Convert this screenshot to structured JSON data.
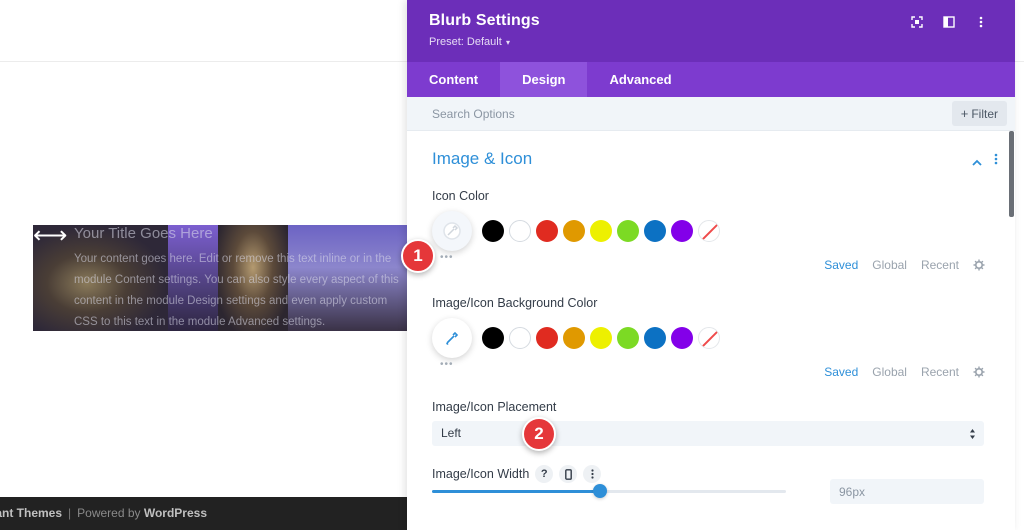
{
  "page": {
    "blurb": {
      "title": "Your Title Goes Here",
      "body": "Your content goes here. Edit or remove this text inline or in the module Content settings. You can also style every aspect of this content in the module Design settings and even apply custom CSS to this text in the module Advanced settings."
    },
    "footer": {
      "brand": "gant Themes",
      "separator": "|",
      "powered": "Powered by",
      "wordpress": "WordPress"
    }
  },
  "modal": {
    "title": "Blurb Settings",
    "preset": "Preset: Default",
    "header_icons": [
      "expand-icon",
      "sidebar-layout-icon",
      "more-vertical-icon"
    ],
    "tabs": [
      {
        "label": "Content",
        "active": false
      },
      {
        "label": "Design",
        "active": true
      },
      {
        "label": "Advanced",
        "active": false
      }
    ],
    "search": {
      "placeholder": "Search Options",
      "filter_label": "Filter"
    },
    "section": {
      "title": "Image & Icon"
    },
    "icon_color": {
      "label": "Icon Color",
      "saved": "Saved",
      "global": "Global",
      "recent": "Recent"
    },
    "bg_color": {
      "label": "Image/Icon Background Color",
      "saved": "Saved",
      "global": "Global",
      "recent": "Recent"
    },
    "swatch_colors": [
      "#000000",
      "#ffffff",
      "#e02b20",
      "#e09900",
      "#edf000",
      "#7cda24",
      "#0c71c3",
      "#8300e9"
    ],
    "placement": {
      "label": "Image/Icon Placement",
      "value": "Left"
    },
    "width": {
      "label": "Image/Icon Width",
      "value": "96px",
      "slider_fraction": 0.475
    },
    "badges": {
      "one": "1",
      "two": "2"
    }
  },
  "colors": {
    "header": "#6c2eb9",
    "tabs": "#7d3bcf",
    "active_tab": "#8e52dc",
    "accent": "#2e8fd8",
    "badge": "#e5373a"
  }
}
